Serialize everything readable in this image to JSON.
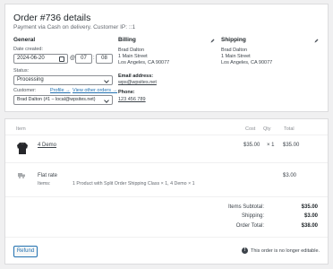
{
  "order": {
    "title": "Order #736 details",
    "subtitle": "Payment via Cash on delivery. Customer IP: ::1"
  },
  "general": {
    "heading": "General",
    "date_label": "Date created:",
    "date_value": "2024-06-20",
    "at": "@",
    "hour": "07",
    "minute": "08",
    "status_label": "Status:",
    "status_value": "Processing",
    "customer_label": "Customer:",
    "profile_link": "Profile →",
    "other_orders_link": "View other orders →",
    "customer_value": "Brad Dalton (#1 – local@wpsites.net)"
  },
  "billing": {
    "heading": "Billing",
    "name": "Brad Dalton",
    "street": "1 Main Street",
    "city": "Los Angeles, CA 90077",
    "email_label": "Email address:",
    "email": "wps@wpsites.net",
    "phone_label": "Phone:",
    "phone": "123 456 789"
  },
  "shipping": {
    "heading": "Shipping",
    "name": "Brad Dalton",
    "street": "1 Main Street",
    "city": "Los Angeles, CA 90077"
  },
  "items_table": {
    "headers": {
      "item": "Item",
      "cost": "Cost",
      "qty": "Qty",
      "total": "Total"
    },
    "product": {
      "name": "4 Demo",
      "cost": "$35.00",
      "qty": "× 1",
      "total": "$35.00"
    },
    "shipping": {
      "method": "Flat rate",
      "items_label": "Items:",
      "items_value": "1 Product with Split Order Shipping Class × 1, 4 Demo × 1",
      "total": "$3.00"
    }
  },
  "totals": {
    "subtotal_label": "Items Subtotal:",
    "subtotal_value": "$35.00",
    "shipping_label": "Shipping:",
    "shipping_value": "$3.00",
    "order_total_label": "Order Total:",
    "order_total_value": "$38.00"
  },
  "actions": {
    "refund_label": "Refund",
    "not_editable": "This order is no longer editable.",
    "info_glyph": "!"
  }
}
